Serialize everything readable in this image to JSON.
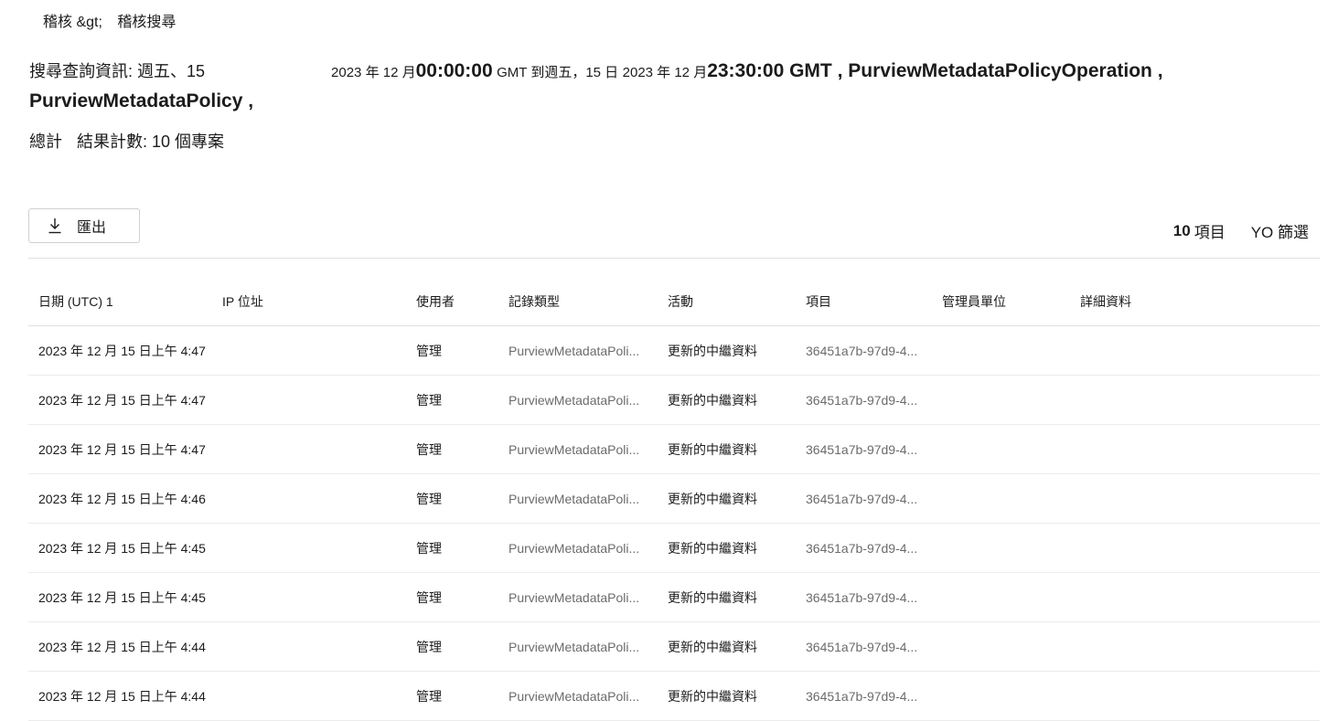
{
  "breadcrumb": {
    "root": "稽核 &gt;",
    "current": "稽核搜尋"
  },
  "query": {
    "p1": "搜尋查詢資訊: 週五、15",
    "p2": "2023 年 12 月",
    "p3": "00:00:00",
    "p4": "GMT 到週五，15 日",
    "p5": "2023 年 12 月",
    "p6": "23:30:00 GMT , PurviewMetadataPolicyOperation ,",
    "p7": "PurviewMetadataPolicy ,"
  },
  "total": {
    "label1": "總計",
    "label2": "結果計數: 10 個專案"
  },
  "toolbar": {
    "export_label": "匯出",
    "item_count_number": "10",
    "item_count_label": "項目",
    "filter_label": "YO 篩選"
  },
  "table": {
    "headers": {
      "date": "日期 (UTC) 1",
      "ip": "IP 位址",
      "user": "使用者",
      "record_type": "記錄類型",
      "activity": "活動",
      "item": "項目",
      "admin_unit": "管理員單位",
      "details": "詳細資料"
    },
    "rows": [
      {
        "date": "2023 年 12 月 15 日上午 4:47",
        "ip": "",
        "user": "管理",
        "record_type": "PurviewMetadataPoli...",
        "activity": "更新的中繼資料",
        "item": "36451a7b-97d9-4...",
        "admin_unit": "",
        "details": ""
      },
      {
        "date": "2023 年 12 月 15 日上午 4:47",
        "ip": "",
        "user": "管理",
        "record_type": "PurviewMetadataPoli...",
        "activity": "更新的中繼資料",
        "item": "36451a7b-97d9-4...",
        "admin_unit": "",
        "details": ""
      },
      {
        "date": "2023 年 12 月 15 日上午 4:47",
        "ip": "",
        "user": "管理",
        "record_type": "PurviewMetadataPoli...",
        "activity": "更新的中繼資料",
        "item": "36451a7b-97d9-4...",
        "admin_unit": "",
        "details": ""
      },
      {
        "date": "2023 年 12 月 15 日上午 4:46",
        "ip": "",
        "user": "管理",
        "record_type": "PurviewMetadataPoli...",
        "activity": "更新的中繼資料",
        "item": "36451a7b-97d9-4...",
        "admin_unit": "",
        "details": ""
      },
      {
        "date": "2023 年 12 月 15 日上午 4:45",
        "ip": "",
        "user": "管理",
        "record_type": "PurviewMetadataPoli...",
        "activity": "更新的中繼資料",
        "item": "36451a7b-97d9-4...",
        "admin_unit": "",
        "details": ""
      },
      {
        "date": "2023 年 12 月 15 日上午 4:45",
        "ip": "",
        "user": "管理",
        "record_type": "PurviewMetadataPoli...",
        "activity": "更新的中繼資料",
        "item": "36451a7b-97d9-4...",
        "admin_unit": "",
        "details": ""
      },
      {
        "date": "2023 年 12 月 15 日上午 4:44",
        "ip": "",
        "user": "管理",
        "record_type": "PurviewMetadataPoli...",
        "activity": "更新的中繼資料",
        "item": "36451a7b-97d9-4...",
        "admin_unit": "",
        "details": ""
      },
      {
        "date": "2023 年 12 月 15 日上午 4:44",
        "ip": "",
        "user": "管理",
        "record_type": "PurviewMetadataPoli...",
        "activity": "更新的中繼資料",
        "item": "36451a7b-97d9-4...",
        "admin_unit": "",
        "details": ""
      }
    ]
  },
  "icons": {
    "export": "download-icon"
  }
}
